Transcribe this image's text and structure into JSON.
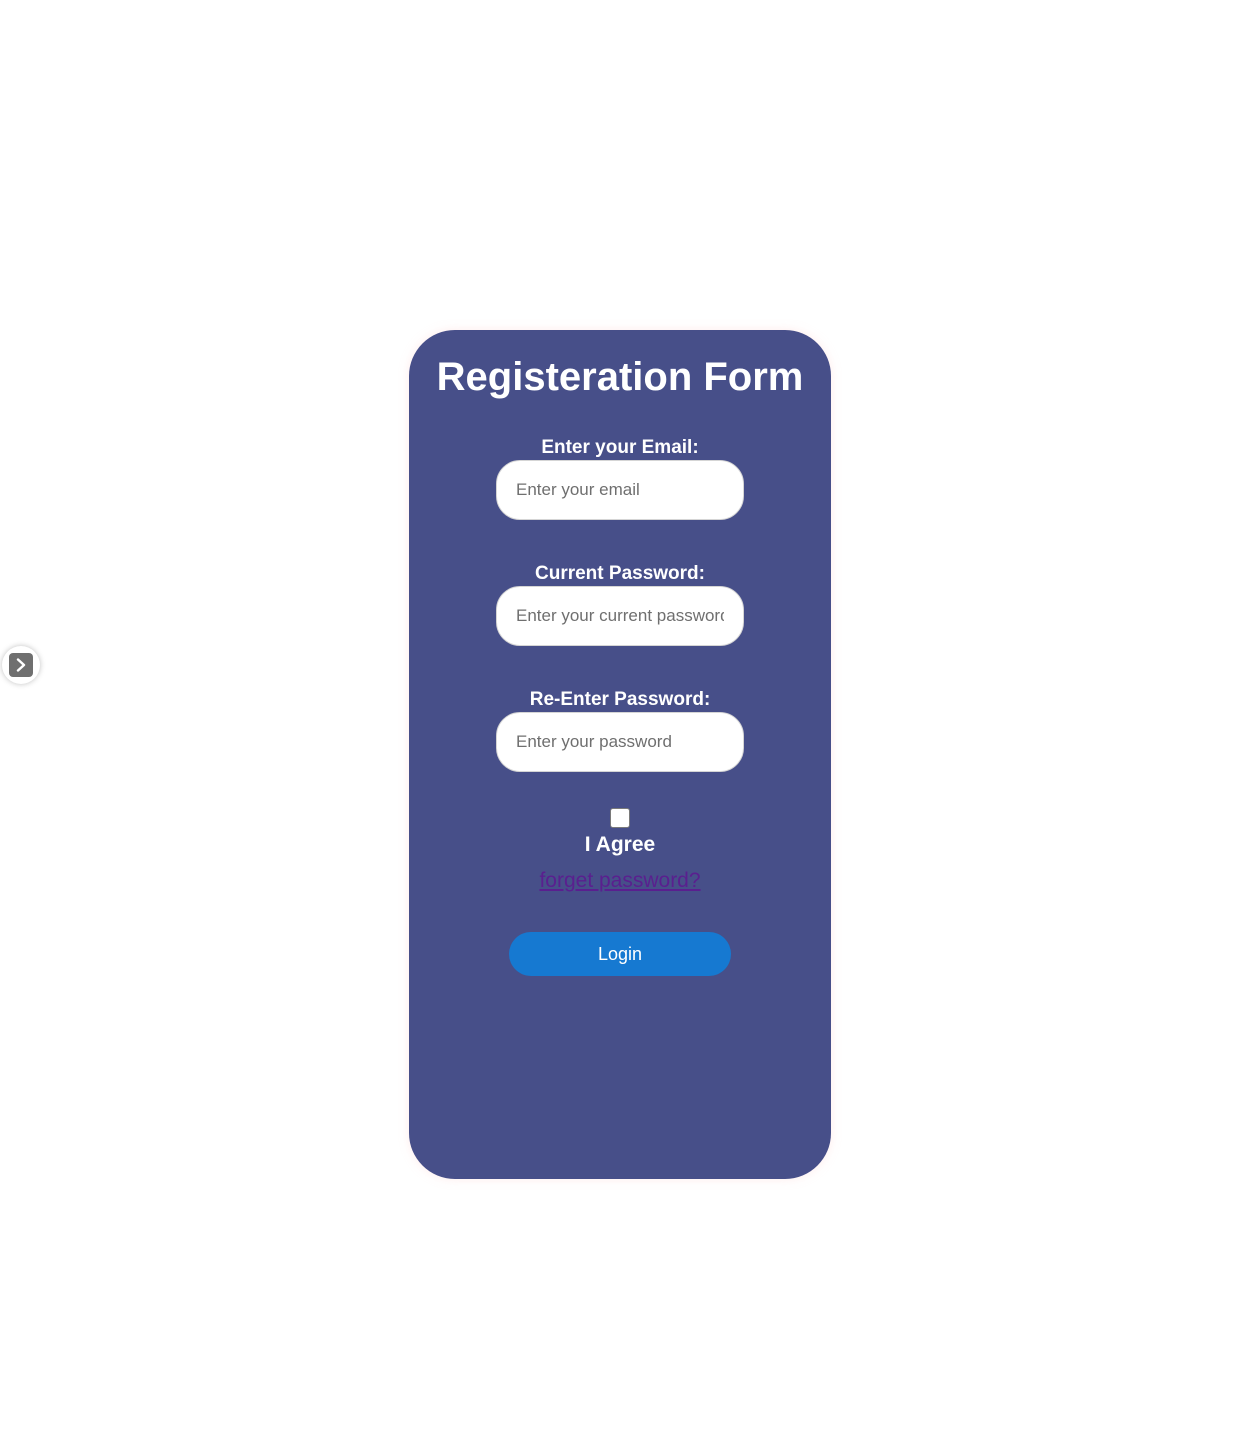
{
  "form": {
    "title": "Registeration Form",
    "email": {
      "label": "Enter your Email:",
      "placeholder": "Enter your email",
      "value": ""
    },
    "current_password": {
      "label": "Current Password:",
      "placeholder": "Enter your current password",
      "value": ""
    },
    "reenter_password": {
      "label": "Re-Enter Password:",
      "placeholder": "Enter your password",
      "value": ""
    },
    "agree": {
      "label": "I Agree",
      "checked": false
    },
    "forget_link": "forget password?",
    "login_label": "Login"
  },
  "side_toggle": {
    "icon": "chevron-right-icon"
  },
  "colors": {
    "card_background": "#474f89",
    "login_button": "#1679d1",
    "link": "#5a1f8f",
    "page_background": "#ffffff"
  }
}
